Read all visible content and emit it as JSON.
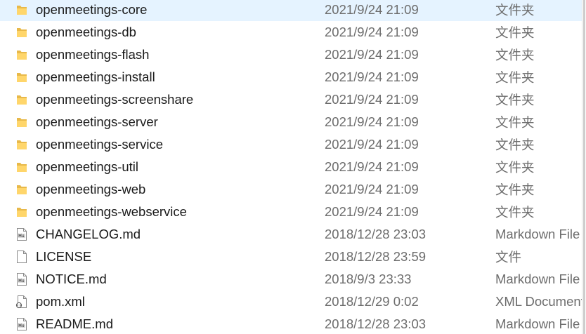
{
  "files": [
    {
      "name": "openmeetings-core",
      "date": "2021/9/24 21:09",
      "type": "文件夹",
      "icon": "folder-icon"
    },
    {
      "name": "openmeetings-db",
      "date": "2021/9/24 21:09",
      "type": "文件夹",
      "icon": "folder-icon"
    },
    {
      "name": "openmeetings-flash",
      "date": "2021/9/24 21:09",
      "type": "文件夹",
      "icon": "folder-icon"
    },
    {
      "name": "openmeetings-install",
      "date": "2021/9/24 21:09",
      "type": "文件夹",
      "icon": "folder-icon"
    },
    {
      "name": "openmeetings-screenshare",
      "date": "2021/9/24 21:09",
      "type": "文件夹",
      "icon": "folder-icon"
    },
    {
      "name": "openmeetings-server",
      "date": "2021/9/24 21:09",
      "type": "文件夹",
      "icon": "folder-icon"
    },
    {
      "name": "openmeetings-service",
      "date": "2021/9/24 21:09",
      "type": "文件夹",
      "icon": "folder-icon"
    },
    {
      "name": "openmeetings-util",
      "date": "2021/9/24 21:09",
      "type": "文件夹",
      "icon": "folder-icon"
    },
    {
      "name": "openmeetings-web",
      "date": "2021/9/24 21:09",
      "type": "文件夹",
      "icon": "folder-icon"
    },
    {
      "name": "openmeetings-webservice",
      "date": "2021/9/24 21:09",
      "type": "文件夹",
      "icon": "folder-icon"
    },
    {
      "name": "CHANGELOG.md",
      "date": "2018/12/28 23:03",
      "type": "Markdown File",
      "icon": "markdown-file-icon"
    },
    {
      "name": "LICENSE",
      "date": "2018/12/28 23:59",
      "type": "文件",
      "icon": "blank-file-icon"
    },
    {
      "name": "NOTICE.md",
      "date": "2018/9/3 23:33",
      "type": "Markdown File",
      "icon": "markdown-file-icon"
    },
    {
      "name": "pom.xml",
      "date": "2018/12/29 0:02",
      "type": "XML Document",
      "icon": "xml-file-icon"
    },
    {
      "name": "README.md",
      "date": "2018/12/28 23:03",
      "type": "Markdown File",
      "icon": "markdown-file-icon"
    }
  ],
  "colors": {
    "folder_back": "#e8b94a",
    "folder_front": "#ffd66b",
    "text_primary": "#1a1a1a",
    "text_secondary": "#6d6d6d"
  }
}
